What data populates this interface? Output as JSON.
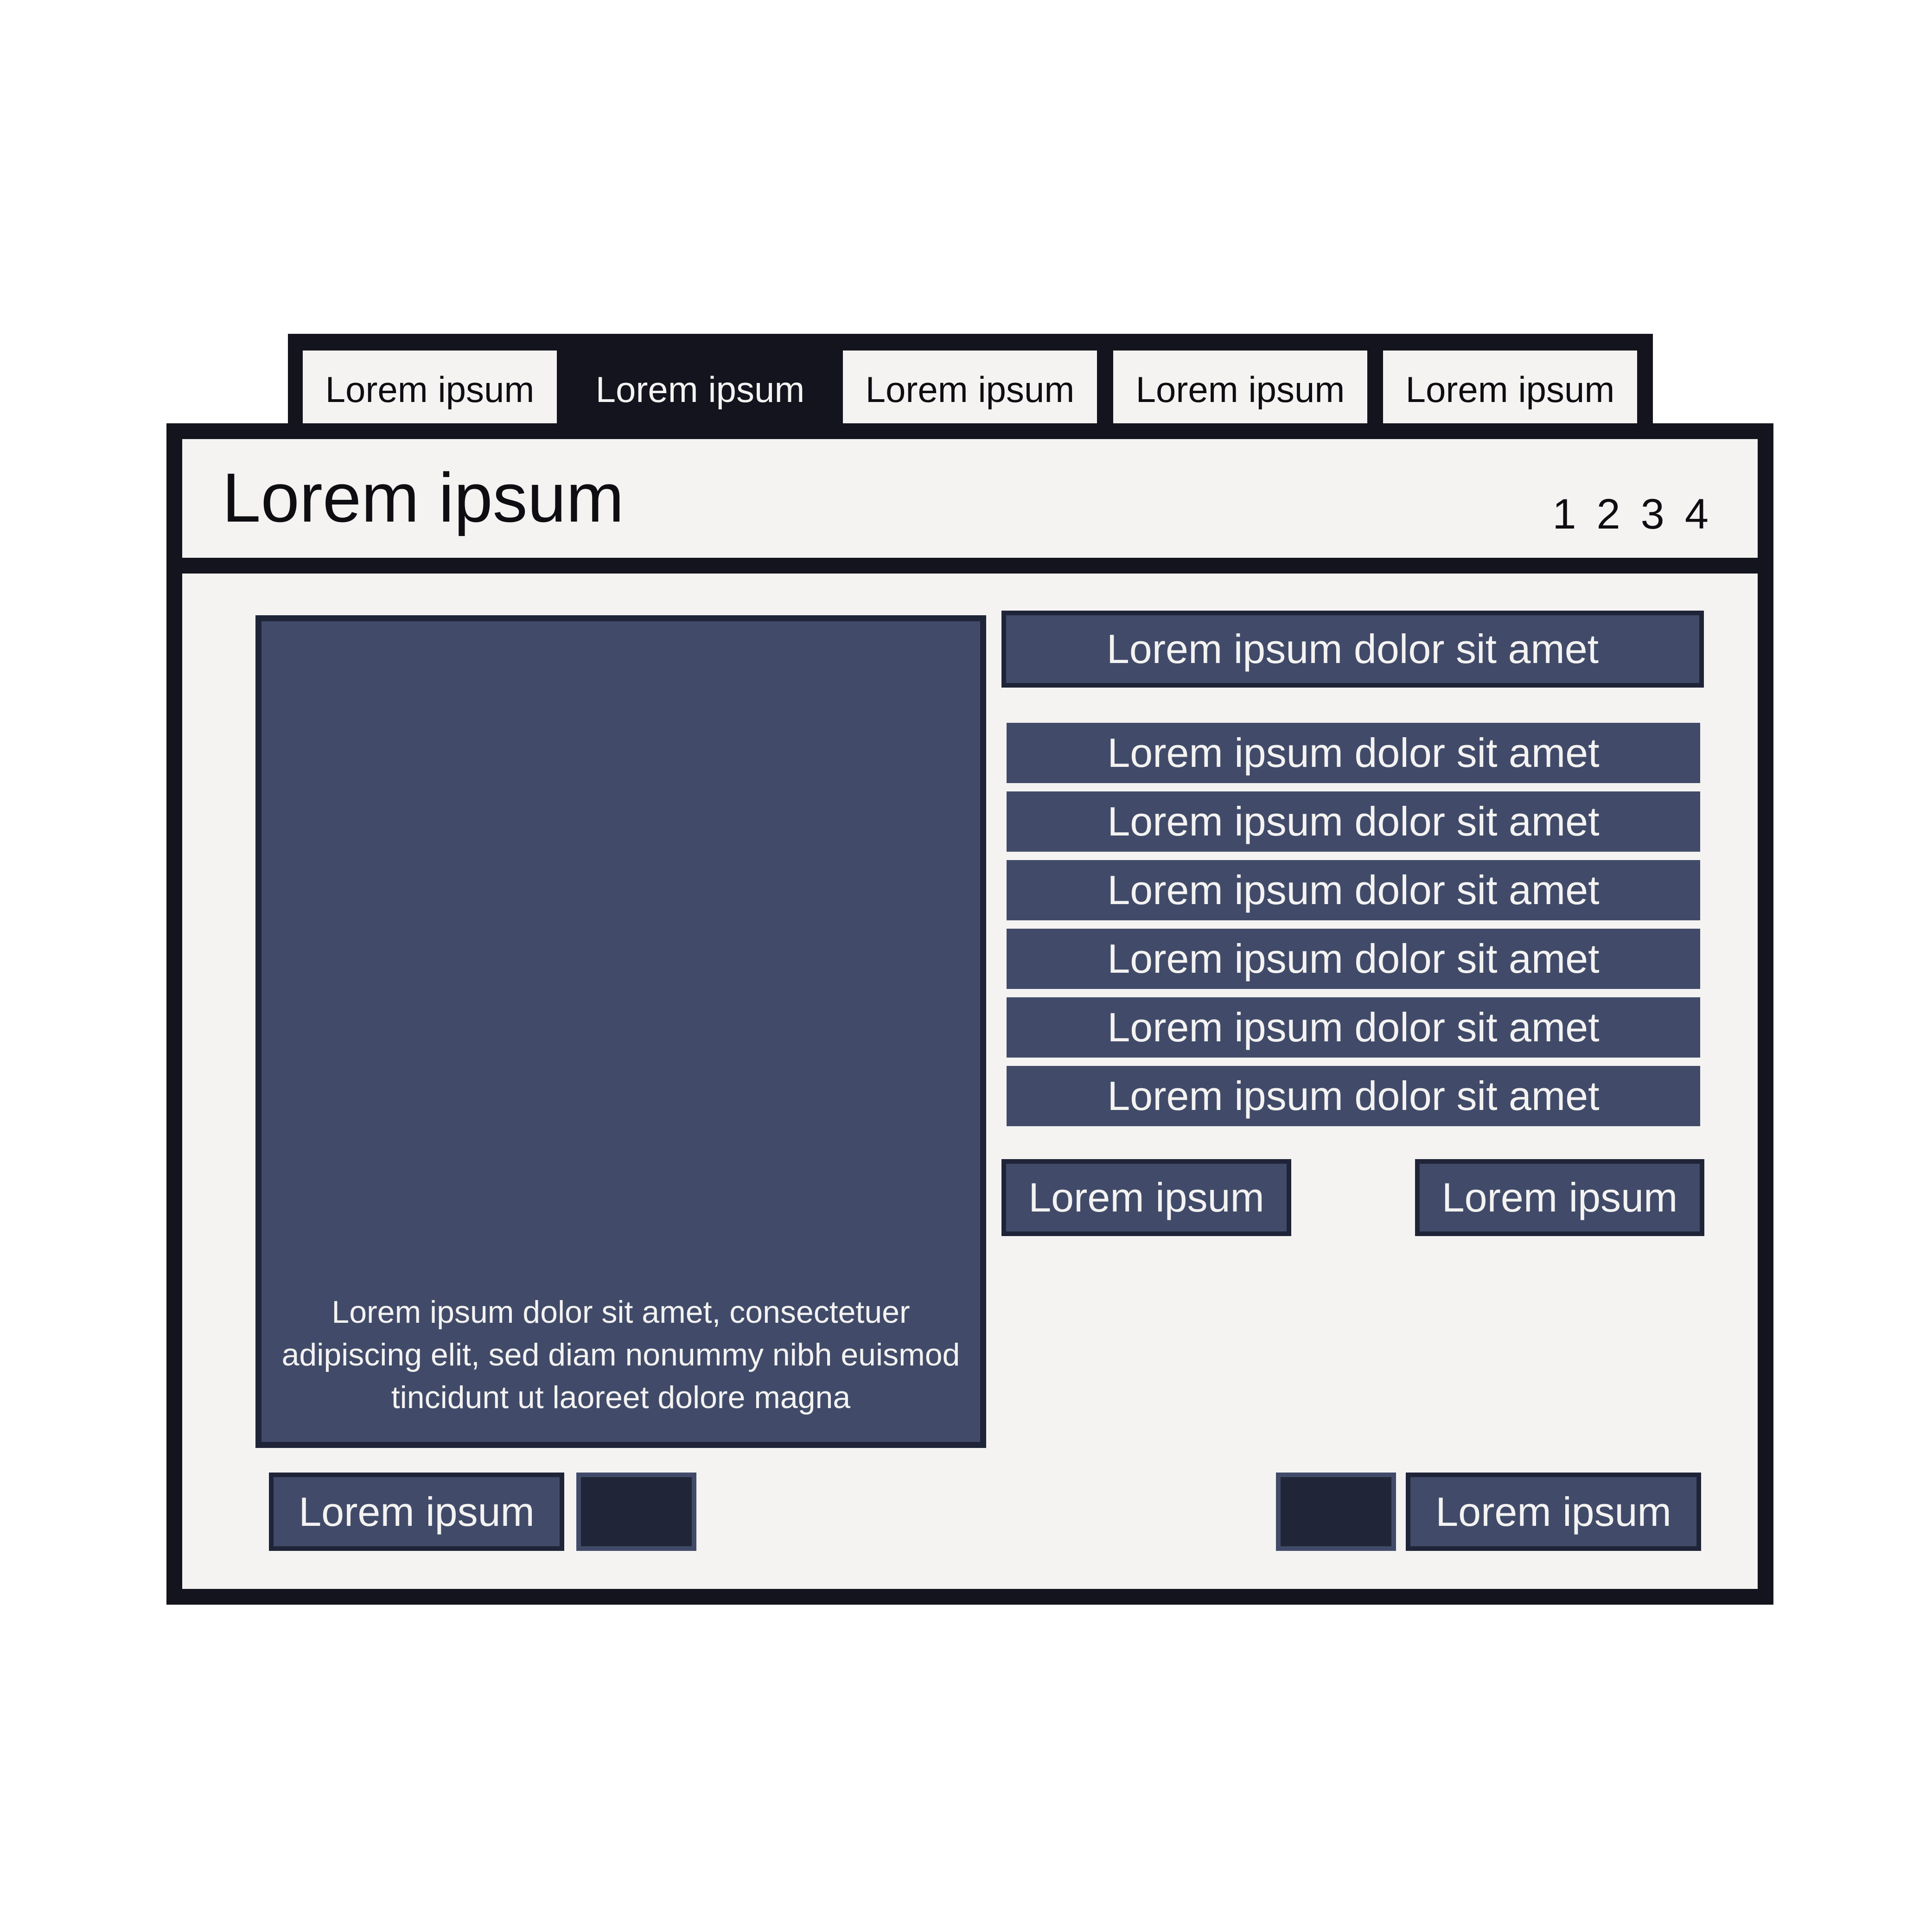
{
  "colors": {
    "frame": "#13141d",
    "background": "#f4f3f2",
    "accent": "#414b69",
    "accent_dark": "#202638",
    "text_dark": "#0e0e12",
    "text_light": "#f4f3f2"
  },
  "tabs": [
    {
      "label": "Lorem ipsum",
      "active": false
    },
    {
      "label": "Lorem ipsum",
      "active": true
    },
    {
      "label": "Lorem ipsum",
      "active": false
    },
    {
      "label": "Lorem ipsum",
      "active": false
    },
    {
      "label": "Lorem ipsum",
      "active": false
    }
  ],
  "header": {
    "title": "Lorem ipsum",
    "pages": [
      "1",
      "2",
      "3",
      "4"
    ]
  },
  "media": {
    "caption": "Lorem ipsum dolor sit amet, consectetuer adipiscing elit, sed diam nonummy nibh euismod tincidunt ut laoreet dolore magna"
  },
  "list": {
    "header": "Lorem ipsum dolor sit amet",
    "items": [
      "Lorem ipsum dolor sit amet",
      "Lorem ipsum dolor sit amet",
      "Lorem ipsum dolor sit amet",
      "Lorem ipsum dolor sit amet",
      "Lorem ipsum dolor sit amet",
      "Lorem ipsum dolor sit amet"
    ]
  },
  "actions": {
    "mid_left": "Lorem ipsum",
    "mid_right": "Lorem ipsum",
    "bottom_left": "Lorem ipsum",
    "bottom_right": "Lorem ipsum"
  }
}
